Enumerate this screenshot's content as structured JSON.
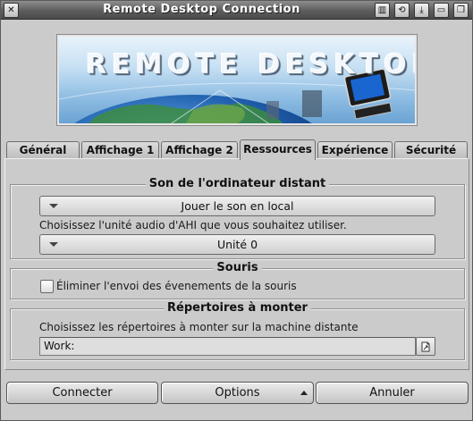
{
  "window": {
    "title": "Remote Desktop Connection"
  },
  "banner": {
    "text": "REMOTE DESKTOP"
  },
  "tabs": [
    {
      "label": "Général"
    },
    {
      "label": "Affichage 1"
    },
    {
      "label": "Affichage 2"
    },
    {
      "label": "Ressources",
      "active": true
    },
    {
      "label": "Expérience"
    },
    {
      "label": "Sécurité"
    }
  ],
  "sound": {
    "title": "Son de l'ordinateur distant",
    "mode_value": "Jouer le son en local",
    "device_hint": "Choisissez l'unité audio d'AHI que vous souhaitez utiliser.",
    "device_value": "Unité 0"
  },
  "mouse": {
    "title": "Souris",
    "suppress_events_label": "Éliminer l'envoi des évenements de la souris",
    "suppress_events_checked": false
  },
  "drives": {
    "title": "Répertoires à monter",
    "hint": "Choisissez les répertoires à monter sur la machine distante",
    "path_value": "Work:"
  },
  "buttons": {
    "connect": "Connecter",
    "options": "Options",
    "cancel": "Annuler"
  },
  "icons": {
    "close": "close-icon",
    "iconify": "iconify-icon",
    "snapshot": "snapshot-icon",
    "jump": "jump-icon",
    "zoom": "zoom-icon",
    "depth": "depth-icon",
    "file": "file-icon"
  }
}
